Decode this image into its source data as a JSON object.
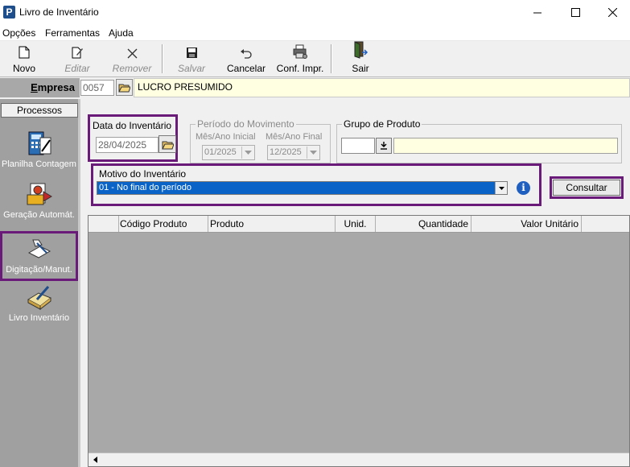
{
  "window": {
    "app_icon_letter": "P",
    "title": "Livro de Inventário"
  },
  "menu": [
    "Opções",
    "Ferramentas",
    "Ajuda"
  ],
  "toolbar": {
    "novo": "Novo",
    "editar": "Editar",
    "remover": "Remover",
    "salvar": "Salvar",
    "cancelar": "Cancelar",
    "conf_impr": "Conf. Impr.",
    "sair": "Sair"
  },
  "empresa": {
    "label_first": "E",
    "label_rest": "mpresa",
    "code": "0057",
    "name": "LUCRO PRESUMIDO"
  },
  "processos": {
    "header": "Processos",
    "items": [
      {
        "label": "Planilha Contagem",
        "icon": "calculator-icon"
      },
      {
        "label": "Geração Automát.",
        "icon": "gear-document-icon"
      },
      {
        "label": "Digitação/Manut.",
        "icon": "hand-writing-icon"
      },
      {
        "label": "Livro Inventário",
        "icon": "book-pen-icon"
      }
    ]
  },
  "form": {
    "data_inventario": {
      "legend": "Data do Inventário",
      "value": "28/04/2025"
    },
    "periodo": {
      "legend": "Período do Movimento",
      "inicial_label": "Mês/Ano Inicial",
      "inicial_value": "01/2025",
      "final_label": "Mês/Ano Final",
      "final_value": "12/2025"
    },
    "grupo": {
      "legend": "Grupo de Produto",
      "code": "",
      "name": ""
    },
    "motivo": {
      "legend": "Motivo do Inventário",
      "value": "01 - No final do período"
    },
    "consultar": "Consultar"
  },
  "grid": {
    "columns": [
      "Código Produto",
      "Produto",
      "Unid.",
      "Quantidade",
      "Valor Unitário"
    ],
    "rows": []
  },
  "colors": {
    "highlight": "#6a1b7a",
    "selection": "#0a64c8",
    "empresa_bg": "#ffffe1",
    "panel_bg": "#a0a0a0"
  }
}
